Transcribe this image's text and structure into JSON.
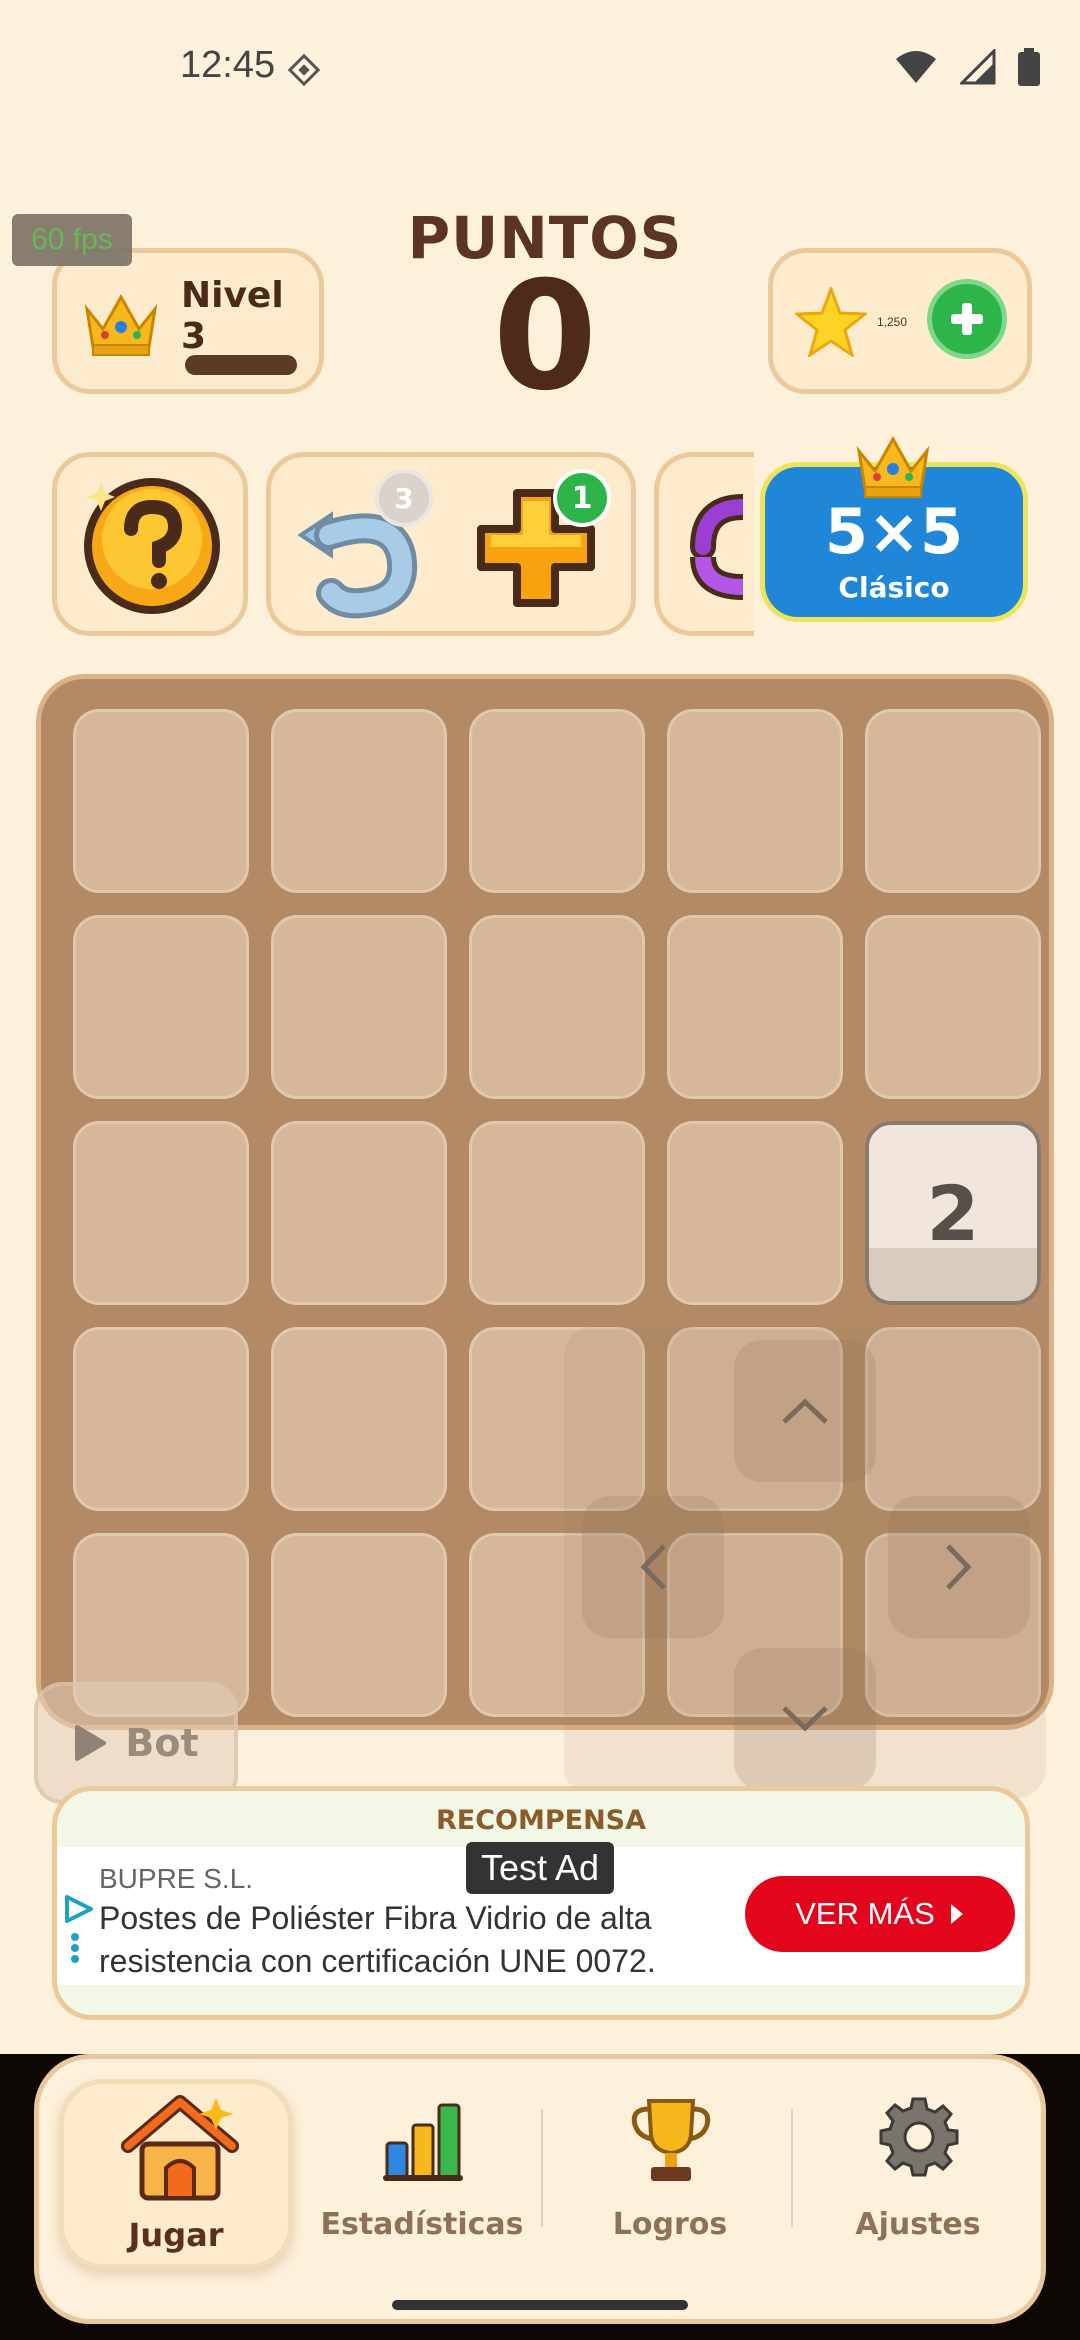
{
  "status_bar": {
    "time": "12:45"
  },
  "fps": "60 fps",
  "header": {
    "score_label": "PUNTOS",
    "score": "0"
  },
  "level": {
    "label": "Nivel 3"
  },
  "currency": {
    "amount": "1,250"
  },
  "tools": {
    "undo_count": "3",
    "add_count": "1"
  },
  "mode": {
    "title": "5×5",
    "subtitle": "Clásico"
  },
  "board": {
    "rows": 5,
    "cols": 5,
    "tiles": [
      {
        "row": 2,
        "col": 4,
        "value": "2"
      }
    ]
  },
  "bot_button": {
    "label": "Bot"
  },
  "ad": {
    "banner_label": "RECOMPENSA",
    "test_badge": "Test Ad",
    "advertiser": "BUPRE S.L.",
    "text": "Postes de Poliéster Fibra Vidrio de alta resistencia con certificación UNE 0072.",
    "cta": "VER MÁS"
  },
  "nav": {
    "items": [
      {
        "label": "Jugar",
        "icon": "house-icon",
        "active": true
      },
      {
        "label": "Estadísticas",
        "icon": "bar-chart-icon",
        "active": false
      },
      {
        "label": "Logros",
        "icon": "trophy-icon",
        "active": false
      },
      {
        "label": "Ajustes",
        "icon": "gear-icon",
        "active": false
      }
    ]
  },
  "colors": {
    "background": "#fdf1dc",
    "board": "#b38a65",
    "mode_badge": "#1f86d8",
    "cta": "#e3051b",
    "add_green": "#2eb54a"
  }
}
